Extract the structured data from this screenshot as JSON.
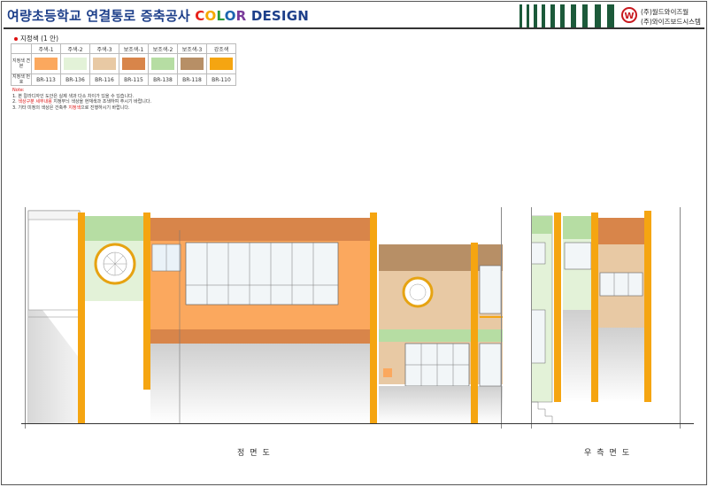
{
  "header": {
    "title_main": "여량초등학교 연결통로 증축공사 ",
    "title_color_letters": [
      {
        "ch": "C",
        "color": "#e7211a"
      },
      {
        "ch": "O",
        "color": "#f5a800"
      },
      {
        "ch": "L",
        "color": "#2a9b3a"
      },
      {
        "ch": "O",
        "color": "#1c64b0"
      },
      {
        "ch": "R",
        "color": "#7a3a9a"
      }
    ],
    "title_tail": " DESIGN",
    "logo_letter": "W",
    "company_line1": "(주)월드와이즈월",
    "company_line2": "(주)와이즈보드시스템"
  },
  "section_label": "지정색 (1 안)",
  "palette": {
    "row_label_sample": "지정색 견본",
    "row_label_code": "지정색 번호",
    "colors": [
      {
        "name": "주색-1",
        "code": "BR-113",
        "hex": "#fba85e"
      },
      {
        "name": "주색-2",
        "code": "BR-136",
        "hex": "#e3f2d8"
      },
      {
        "name": "주색-3",
        "code": "BR-116",
        "hex": "#e8c9a4"
      },
      {
        "name": "보조색-1",
        "code": "BR-115",
        "hex": "#d8854a"
      },
      {
        "name": "보조색-2",
        "code": "BR-138",
        "hex": "#b6dda3"
      },
      {
        "name": "보조색-3",
        "code": "BR-118",
        "hex": "#b78f66"
      },
      {
        "name": "강조색",
        "code": "BR-110",
        "hex": "#f5a511"
      }
    ]
  },
  "notes": {
    "title": "Note:",
    "line1": "1. 본 칼라디자인 도안은 실제 색과 다소 차이가 있을 수 있습니다.",
    "line2_a": "2. ",
    "line2_hl": "색상구분 세부내용",
    "line2_b": " 지정무늬 색상을 현재색과 조색하여 주시기 바랍니다.",
    "line3_a": "3. 기타 미정의 색상은 건축주 ",
    "line3_hl": "지정색",
    "line3_b": "으로 진행하시기 바랍니다."
  },
  "captions": {
    "front": "정면도",
    "side": "우측면도"
  }
}
